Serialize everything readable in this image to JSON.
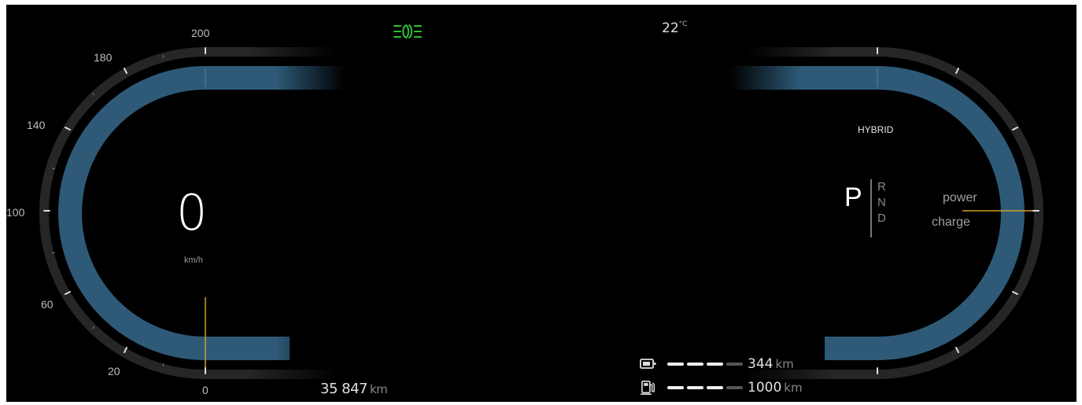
{
  "speedometer": {
    "speed_value": "0",
    "speed_unit": "km/h",
    "ticks": [
      "200",
      "180",
      "140",
      "100",
      "60",
      "20",
      "0"
    ],
    "speed_level": 0
  },
  "top_bar": {
    "headlight_icon": "headlight-indicator-icon",
    "headlight_color": "#2fbf3a",
    "temperature": "22",
    "temperature_unit": "°C"
  },
  "odometer": {
    "value": "35 847",
    "unit": "km"
  },
  "drive": {
    "mode": "HYBRID",
    "selected_gear": "P",
    "other_gears": [
      "R",
      "N",
      "D"
    ],
    "power_label": "power",
    "charge_label": "charge"
  },
  "range": {
    "battery": {
      "icon": "battery-icon",
      "value": "344",
      "unit": "km",
      "level_segments_on": 3,
      "level_segments_total": 4
    },
    "fuel": {
      "icon": "fuel-pump-icon",
      "value": "1000",
      "unit": "km",
      "level_segments_on": 3,
      "level_segments_total": 4
    }
  },
  "colors": {
    "gauge_fill": "#2e5a78",
    "needle": "#d4a020",
    "background": "#000000"
  }
}
